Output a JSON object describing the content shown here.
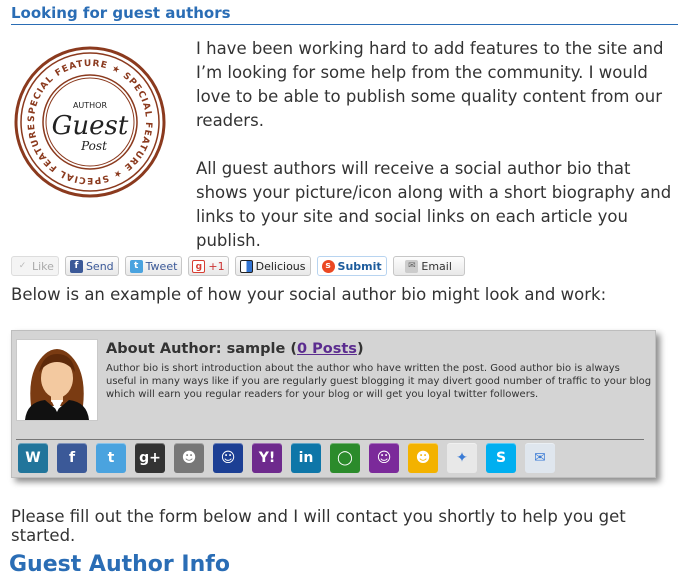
{
  "page": {
    "title": "Looking for guest authors"
  },
  "stamp": {
    "ring_text": "SPECIAL FEATURE",
    "top": "AUTHOR",
    "middle": "Guest",
    "bottom": "Post"
  },
  "intro": {
    "paragraph1": "I have been working hard to add features to the site and I’m looking for some help from the community.  I would love to be able to publish some quality content from our readers.",
    "paragraph2": "All guest authors will receive a social author bio that shows your picture/icon along with a short biography and links to your site and social links on each article you publish."
  },
  "share": {
    "like": "Like",
    "send": "Send",
    "tweet": "Tweet",
    "gplus": "+1",
    "delicious": "Delicious",
    "submit": "Submit",
    "email": "Email"
  },
  "example_text": "Below is an example of how your social author bio might look and work:",
  "bio": {
    "heading_prefix": "About Author: sample (",
    "posts_link": "0 Posts",
    "heading_suffix": ")",
    "text": "Author bio is short introduction about the author who have written the post. Good author bio is always useful in many ways like if you are regularly guest blogging it may divert good number of traffic to your blog which will earn you regular readers for your blog or will get you loyal twitter followers.",
    "icons": [
      {
        "name": "wordpress-icon",
        "glyph": "W",
        "color": "#21759b"
      },
      {
        "name": "facebook-icon",
        "glyph": "f",
        "color": "#3b5998"
      },
      {
        "name": "twitter-icon",
        "glyph": "t",
        "color": "#4aa3df"
      },
      {
        "name": "google-plus-icon",
        "glyph": "g+",
        "color": "#333333"
      },
      {
        "name": "people-icon",
        "glyph": "☻",
        "color": "#777777"
      },
      {
        "name": "myspace-icon",
        "glyph": "☺",
        "color": "#1c3f94"
      },
      {
        "name": "yahoo-icon",
        "glyph": "Y!",
        "color": "#6e2a8d"
      },
      {
        "name": "linkedin-icon",
        "glyph": "in",
        "color": "#0e76a8"
      },
      {
        "name": "chat-icon",
        "glyph": "◯",
        "color": "#2b8b2b"
      },
      {
        "name": "messenger-icon",
        "glyph": "☺",
        "color": "#7b2a9a"
      },
      {
        "name": "aim-icon",
        "glyph": "☻",
        "color": "#f3b200"
      },
      {
        "name": "msn-icon",
        "glyph": "✦",
        "color": "#e8e8e8"
      },
      {
        "name": "skype-icon",
        "glyph": "S",
        "color": "#00aff0"
      },
      {
        "name": "mail-icon",
        "glyph": "✉",
        "color": "#dfe6ee"
      }
    ]
  },
  "fill_text": "Please fill out the form below and I will contact you shortly to help you get started.",
  "section_title": "Guest Author Info"
}
